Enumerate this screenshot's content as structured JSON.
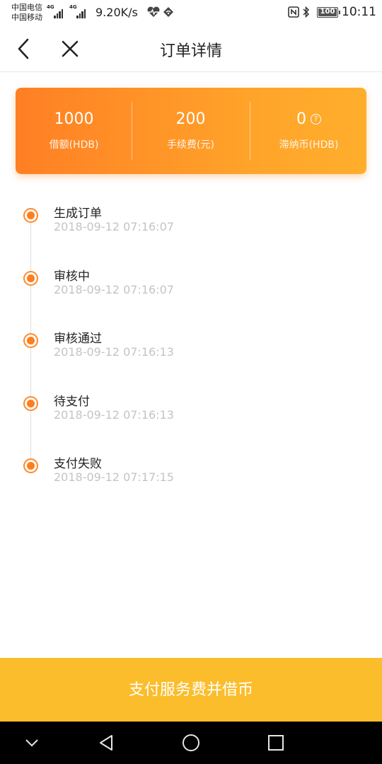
{
  "status_bar": {
    "carrier_1": "中国电信",
    "carrier_2": "中国移动",
    "network_1": "4G",
    "network_2": "4G",
    "speed": "9.20K/s",
    "battery": "100",
    "time": "10:11"
  },
  "nav": {
    "title": "订单详情",
    "back_icon": "chevron-left-icon",
    "close_icon": "close-icon"
  },
  "summary": {
    "items": [
      {
        "value": "1000",
        "label": "借额(HDB)"
      },
      {
        "value": "200",
        "label": "手续费(元)"
      },
      {
        "value": "0",
        "label": "滞纳币(HDB)",
        "help": "?"
      }
    ]
  },
  "timeline": [
    {
      "title": "生成订单",
      "time": "2018-09-12 07:16:07"
    },
    {
      "title": "审核中",
      "time": "2018-09-12 07:16:07"
    },
    {
      "title": "审核通过",
      "time": "2018-09-12 07:16:13"
    },
    {
      "title": "待支付",
      "time": "2018-09-12 07:16:13"
    },
    {
      "title": "支付失败",
      "time": "2018-09-12 07:17:15"
    }
  ],
  "action": {
    "label": "支付服务费并借币"
  },
  "colors": {
    "accent_orange": "#ff7f24",
    "button_yellow": "#fbbd2b",
    "timeline_dot": "#ff7d1d"
  }
}
